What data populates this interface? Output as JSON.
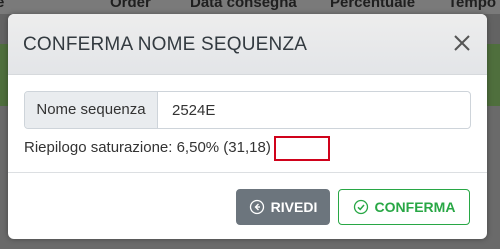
{
  "background": {
    "headers": [
      "e",
      "Order",
      "Data consegna",
      "Percentuale",
      "Tempo"
    ]
  },
  "modal": {
    "title": "CONFERMA NOME SEQUENZA",
    "close_icon": "close-icon",
    "field_label": "Nome sequenza",
    "field_value": "2524E",
    "summary_text": "Riepilogo saturazione: 6,50% (31,18)",
    "buttons": {
      "rivedi": {
        "label": "RIVEDI",
        "icon": "arrow-left-circle-icon"
      },
      "conferma": {
        "label": "CONFERMA",
        "icon": "check-circle-icon"
      }
    }
  },
  "colors": {
    "accent_green": "#28a745",
    "secondary_gray": "#6c757d",
    "highlight_red": "#d0021b"
  }
}
